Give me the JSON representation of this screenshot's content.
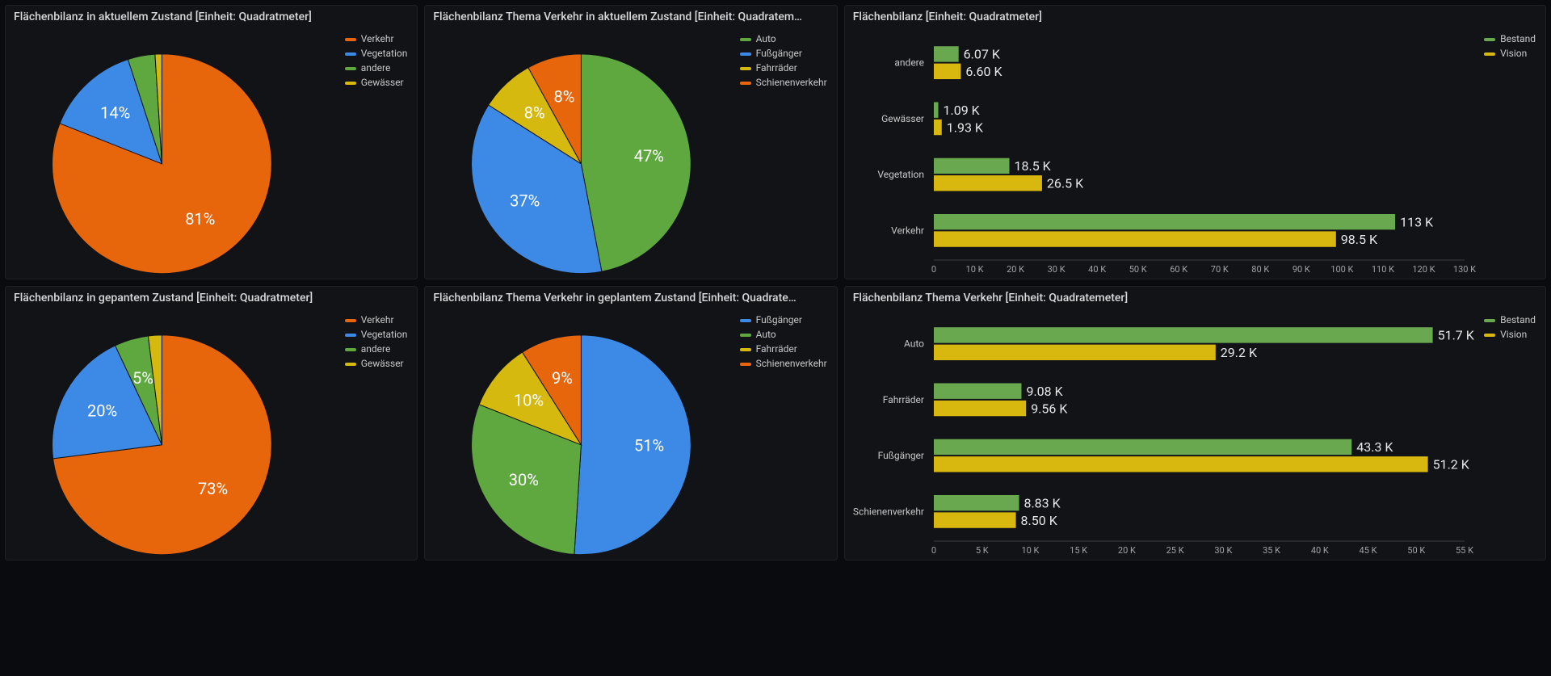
{
  "panels": {
    "p0": {
      "title": "Flächenbilanz in aktuellem Zustand [Einheit: Quadratmeter]"
    },
    "p1": {
      "title": "Flächenbilanz Thema Verkehr in aktuellem Zustand [Einheit: Quadratem…"
    },
    "p2": {
      "title": "Flächenbilanz [Einheit: Quadratmeter]"
    },
    "p3": {
      "title": "Flächenbilanz in gepantem Zustand [Einheit: Quadratmeter]"
    },
    "p4": {
      "title": "Flächenbilanz Thema Verkehr in geplantem Zustand [Einheit: Quadrate…"
    },
    "p5": {
      "title": "Flächenbilanz Thema Verkehr [Einheit: Quadratemeter]"
    }
  },
  "colors": {
    "orange": "#e8660b",
    "blue": "#3d8ae6",
    "green": "#5ea83f",
    "yellow": "#d6b90f",
    "bar_green": "#6aa84f",
    "bar_yellow": "#d8b80e"
  },
  "chart_data": [
    {
      "id": "p0",
      "type": "pie",
      "slices": [
        {
          "name": "Verkehr",
          "pct": 81,
          "color": "orange",
          "show_label": true
        },
        {
          "name": "Vegetation",
          "pct": 14,
          "color": "blue",
          "show_label": true
        },
        {
          "name": "andere",
          "pct": 4,
          "color": "green",
          "show_label": false
        },
        {
          "name": "Gewässer",
          "pct": 1,
          "color": "yellow",
          "show_label": false
        }
      ],
      "legend_order": [
        "Verkehr",
        "Vegetation",
        "andere",
        "Gewässer"
      ]
    },
    {
      "id": "p1",
      "type": "pie",
      "slices": [
        {
          "name": "Auto",
          "pct": 47,
          "color": "green",
          "show_label": true
        },
        {
          "name": "Fußgänger",
          "pct": 37,
          "color": "blue",
          "show_label": true
        },
        {
          "name": "Fahrräder",
          "pct": 8,
          "color": "yellow",
          "show_label": true
        },
        {
          "name": "Schienenverkehr",
          "pct": 8,
          "color": "orange",
          "show_label": true
        }
      ],
      "legend_order": [
        "Auto",
        "Fußgänger",
        "Fahrräder",
        "Schienenverkehr"
      ]
    },
    {
      "id": "p3",
      "type": "pie",
      "slices": [
        {
          "name": "Verkehr",
          "pct": 73,
          "color": "orange",
          "show_label": true
        },
        {
          "name": "Vegetation",
          "pct": 20,
          "color": "blue",
          "show_label": true
        },
        {
          "name": "andere",
          "pct": 5,
          "color": "green",
          "show_label": true
        },
        {
          "name": "Gewässer",
          "pct": 2,
          "color": "yellow",
          "show_label": false
        }
      ],
      "legend_order": [
        "Verkehr",
        "Vegetation",
        "andere",
        "Gewässer"
      ]
    },
    {
      "id": "p4",
      "type": "pie",
      "slices": [
        {
          "name": "Fußgänger",
          "pct": 51,
          "color": "blue",
          "show_label": true
        },
        {
          "name": "Auto",
          "pct": 30,
          "color": "green",
          "show_label": true
        },
        {
          "name": "Fahrräder",
          "pct": 10,
          "color": "yellow",
          "show_label": true
        },
        {
          "name": "Schienenverkehr",
          "pct": 9,
          "color": "orange",
          "show_label": true
        }
      ],
      "legend_order": [
        "Fußgänger",
        "Auto",
        "Fahrräder",
        "Schienenverkehr"
      ]
    },
    {
      "id": "p2",
      "type": "grouped_hbar",
      "categories": [
        "andere",
        "Gewässer",
        "Vegetation",
        "Verkehr"
      ],
      "series": [
        {
          "name": "Bestand",
          "color": "bar_green",
          "values": [
            6070,
            1090,
            18500,
            113000
          ],
          "labels": [
            "6.07 K",
            "1.09 K",
            "18.5 K",
            "113 K"
          ]
        },
        {
          "name": "Vision",
          "color": "bar_yellow",
          "values": [
            6600,
            1930,
            26500,
            98500
          ],
          "labels": [
            "6.60 K",
            "1.93 K",
            "26.5 K",
            "98.5 K"
          ]
        }
      ],
      "x_axis": {
        "min": 0,
        "max": 130000,
        "step": 10000,
        "tick_format": "k_short"
      }
    },
    {
      "id": "p5",
      "type": "grouped_hbar",
      "categories": [
        "Auto",
        "Fahrräder",
        "Fußgänger",
        "Schienenverkehr"
      ],
      "series": [
        {
          "name": "Bestand",
          "color": "bar_green",
          "values": [
            51700,
            9080,
            43300,
            8830
          ],
          "labels": [
            "51.7 K",
            "9.08 K",
            "43.3 K",
            "8.83 K"
          ]
        },
        {
          "name": "Vision",
          "color": "bar_yellow",
          "values": [
            29200,
            9560,
            51200,
            8500
          ],
          "labels": [
            "29.2 K",
            "9.56 K",
            "51.2 K",
            "8.50 K"
          ]
        }
      ],
      "x_axis": {
        "min": 0,
        "max": 55000,
        "step": 5000,
        "tick_format": "k_short"
      }
    }
  ]
}
